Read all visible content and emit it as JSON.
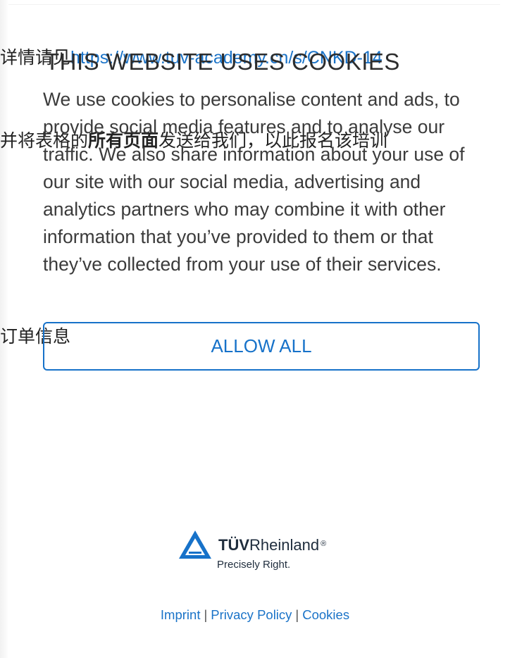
{
  "background_page": {
    "line1_prefix": "详情请见",
    "line1_link": "https://www.tuv-academy.cn/s/CNKD-14",
    "line2_prefix": "并将表格的",
    "line2_bold": "所有页面",
    "line2_suffix": "发送给我们，以此报名该培训",
    "line3": "订单信息"
  },
  "cookie_banner": {
    "title": "THIS WEBSITE USES COOKIES",
    "body": "We use cookies to personalise content and ads, to provide social media features and to analyse our traffic. We also share information about your use of our site with our social media, advertising and analytics partners who may combine it with other information that you’ve provided to them or that they’ve collected from your use of their services.",
    "allow_all_label": "ALLOW ALL"
  },
  "logo": {
    "brand_bold": "TÜV",
    "brand_regular": "Rheinland",
    "registered_mark": "®",
    "tagline": "Precisely Right."
  },
  "footer": {
    "links": [
      "Imprint",
      "Privacy Policy",
      "Cookies"
    ],
    "separator": "|"
  },
  "colors": {
    "accent": "#1772c9",
    "link": "#1a73c8",
    "text": "#3b3b3b"
  }
}
